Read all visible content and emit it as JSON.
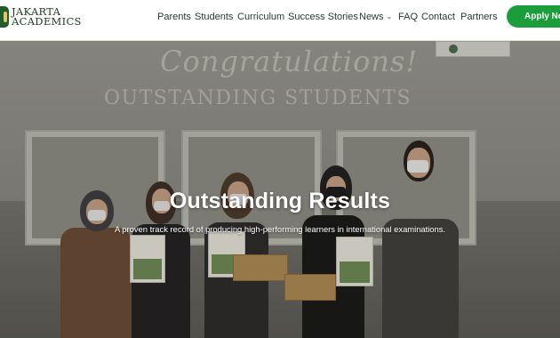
{
  "header": {
    "logo": {
      "line1": "JAKARTA",
      "line2": "ACADEMICS"
    },
    "nav": [
      {
        "label": "Parents"
      },
      {
        "label": "Students"
      },
      {
        "label": "Curriculum"
      },
      {
        "label": "Success Stories"
      },
      {
        "label": "News",
        "has_dropdown": true
      },
      {
        "label": "FAQ"
      },
      {
        "label": "Contact"
      },
      {
        "label": "Partners"
      }
    ],
    "apply_button": "Apply Now"
  },
  "hero": {
    "title": "Outstanding Results",
    "subtitle": "A proven track record of producing high-performing learners in international examinations.",
    "background_banner": {
      "script_text": "Congratulations!",
      "headline": "OUTSTANDING STUDENTS"
    }
  },
  "colors": {
    "brand_green": "#1a9e3b",
    "logo_green": "#1f5e2b",
    "nav_text": "#1f3b30"
  },
  "icons": {
    "news_dropdown": "chevron-down-icon"
  }
}
